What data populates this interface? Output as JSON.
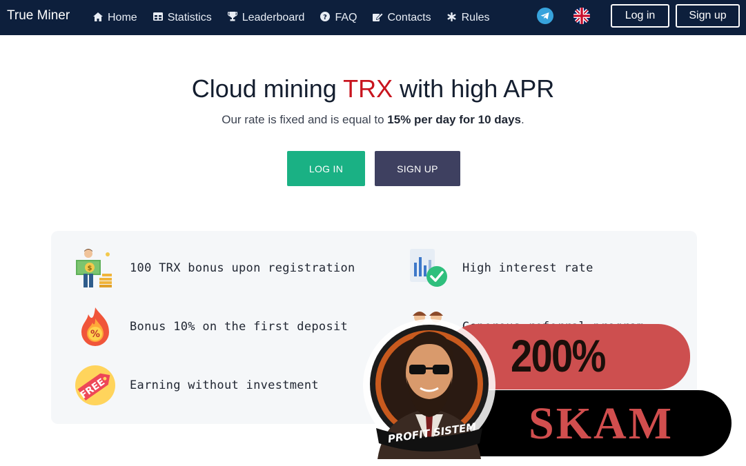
{
  "nav": {
    "brand": "True Miner",
    "items": [
      {
        "label": "Home",
        "icon": "home-icon"
      },
      {
        "label": "Statistics",
        "icon": "table-icon"
      },
      {
        "label": "Leaderboard",
        "icon": "trophy-icon"
      },
      {
        "label": "FAQ",
        "icon": "question-icon"
      },
      {
        "label": "Contacts",
        "icon": "edit-icon"
      },
      {
        "label": "Rules",
        "icon": "asterisk-icon"
      }
    ],
    "login_label": "Log in",
    "signup_label": "Sign up"
  },
  "hero": {
    "title_pre": "Cloud mining ",
    "title_accent": "TRX",
    "title_post": " with high APR",
    "subtitle_pre": "Our rate is fixed and is equal to ",
    "subtitle_bold": "15% per day for 10 days",
    "subtitle_post": ".",
    "login_button": "LOG IN",
    "signup_button": "SIGN UP"
  },
  "features": [
    {
      "text": "100 TRX bonus upon registration",
      "icon": "money-man-icon"
    },
    {
      "text": "High interest rate",
      "icon": "chart-check-icon"
    },
    {
      "text": "Bonus 10% on the first deposit",
      "icon": "percent-fire-icon"
    },
    {
      "text": "Generous referral program",
      "icon": "people-icon"
    },
    {
      "text": "Earning without investment",
      "icon": "free-tag-icon"
    }
  ],
  "overlay": {
    "badge_text": "PROFIT SISTEM",
    "red_pill_text": "200%",
    "black_pill_text": "SKAM"
  },
  "colors": {
    "nav_bg": "#0d1f3c",
    "accent_red": "#c8141e",
    "login_green": "#1ab184",
    "signup_slate": "#3e4060",
    "overlay_red": "#cd4f4f"
  }
}
